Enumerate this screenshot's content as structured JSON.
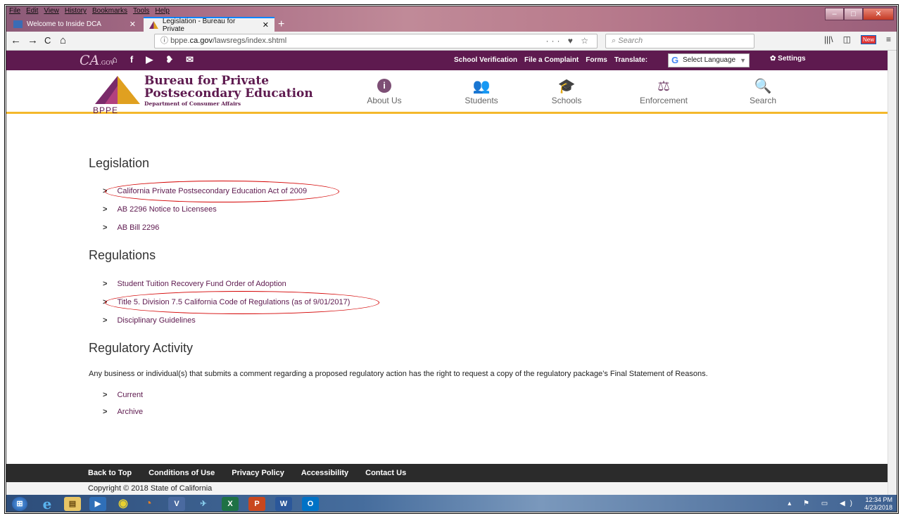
{
  "browser": {
    "menu": [
      "File",
      "Edit",
      "View",
      "History",
      "Bookmarks",
      "Tools",
      "Help"
    ],
    "tabs": [
      {
        "label": "Welcome to Inside DCA"
      },
      {
        "label": "Legislation - Bureau for Private"
      }
    ],
    "close_glyph": "✕",
    "new_tab_glyph": "+",
    "window_controls": {
      "minimize": "–",
      "maximize": "□",
      "close": "✕"
    },
    "nav": {
      "back": "←",
      "forward": "→",
      "reload": "C",
      "home": "⌂"
    },
    "url_info_icon": "ⓘ",
    "url_prefix": "bppe.",
    "url_domain": "ca.gov",
    "url_path": "/lawsregs/index.shtml",
    "url_actions": "··· ♥ ☆",
    "search_placeholder": "Search",
    "toolbar_icons": {
      "library": "|||\\",
      "sidebar": "◫",
      "badge": "New",
      "menu": "≡"
    }
  },
  "site": {
    "ca_logo": "CA",
    "ca_logo_small": ".GOV",
    "social_icons": {
      "home": "⌂",
      "facebook": "f",
      "youtube": "▶",
      "twitter": "❥",
      "email": "✉"
    },
    "utility_links": [
      "School Verification",
      "File a Complaint",
      "Forms",
      "Translate:"
    ],
    "language": {
      "g": "G",
      "label": "Select Language",
      "arrow": "▼"
    },
    "settings_label": "Settings",
    "settings_icon": "✿",
    "org": {
      "line1": "Bureau for Private",
      "line2": "Postsecondary Education",
      "line3": "Department of Consumer Affairs",
      "acronym": "BPPE"
    },
    "nav": [
      {
        "label": "About Us",
        "icon": "i"
      },
      {
        "label": "Students",
        "icon": "👥"
      },
      {
        "label": "Schools",
        "icon": "🎓"
      },
      {
        "label": "Enforcement",
        "icon": "⚖"
      },
      {
        "label": "Search",
        "icon": "🔍"
      }
    ],
    "chevron": ">",
    "sections": {
      "legislation": {
        "heading": "Legislation",
        "links": [
          "California Private Postsecondary Education Act of 2009",
          "AB 2296 Notice to Licensees",
          "AB Bill 2296"
        ]
      },
      "regulations": {
        "heading": "Regulations",
        "links": [
          "Student Tuition Recovery Fund Order of Adoption",
          "Title 5. Division 7.5 California Code of Regulations (as of 9/01/2017)",
          "Disciplinary Guidelines"
        ]
      },
      "regulatory_activity": {
        "heading": "Regulatory Activity",
        "paragraph": "Any business or individual(s) that submits a comment regarding a proposed regulatory action has the right to request a copy of the regulatory package’s Final Statement of Reasons.",
        "links": [
          "Current",
          "Archive"
        ]
      }
    },
    "footer_links": [
      "Back to Top",
      "Conditions of Use",
      "Privacy Policy",
      "Accessibility",
      "Contact Us"
    ],
    "copyright": "Copyright © 2018 State of California"
  },
  "taskbar": {
    "apps": [
      "⊞",
      "e",
      "▤",
      "▶",
      "◉",
      "◔",
      "V",
      "✈",
      "X",
      "P",
      "W",
      "O"
    ],
    "tray_icons": "▴ ⚑ ▭ ◀)",
    "time": "12:34 PM",
    "date": "4/23/2018"
  }
}
